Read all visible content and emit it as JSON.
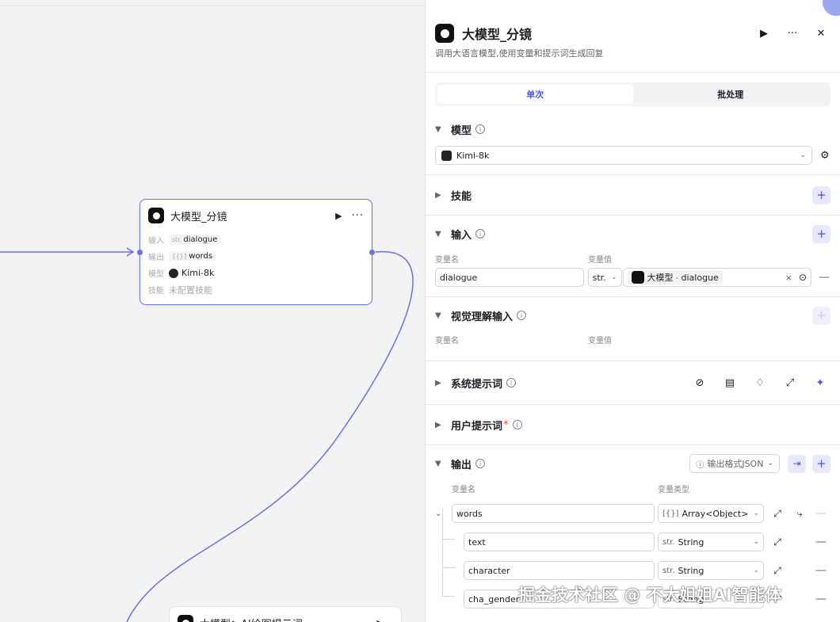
{
  "canvas": {
    "node_main": {
      "title": "大模型_分镜",
      "input_label": "输入",
      "input_type": "str.",
      "input_value": "dialogue",
      "output_label": "输出",
      "output_type": "[{}]",
      "output_value": "words",
      "model_label": "模型",
      "model_value": "Kimi-8k",
      "skill_label": "技能",
      "skill_value": "未配置技能"
    },
    "node_second": {
      "title": "大模型：AI绘图提示词"
    },
    "edge_color": "#6b6fe0"
  },
  "panel": {
    "title": "大模型_分镜",
    "description": "调用大语言模型,使用变量和提示词生成回复",
    "tabs": [
      {
        "label": "单次",
        "active": true
      },
      {
        "label": "批处理",
        "active": false
      }
    ],
    "model_section": {
      "title": "模型",
      "selected": "Kimi-8k"
    },
    "skill_section": {
      "title": "技能"
    },
    "input_section": {
      "title": "输入",
      "col_name": "变量名",
      "col_value": "变量值",
      "row": {
        "name": "dialogue",
        "type": "str.",
        "ref_node": "大模型",
        "ref_sep": "-",
        "ref_var": "dialogue"
      }
    },
    "visual_section": {
      "title": "视觉理解输入",
      "col_name": "变量名",
      "col_value": "变量值"
    },
    "system_prompt_section": {
      "title": "系统提示词"
    },
    "user_prompt_section": {
      "title": "用户提示词",
      "required_mark": "*"
    },
    "output_section": {
      "title": "输出",
      "format_label": "输出格式JSON",
      "col_name": "变量名",
      "col_type": "变量类型",
      "rows": [
        {
          "name": "words",
          "type_prefix": "[{}]",
          "type": "Array<Object>"
        },
        {
          "name": "text",
          "type_prefix": "str.",
          "type": "String"
        },
        {
          "name": "character",
          "type_prefix": "str.",
          "type": "String"
        },
        {
          "name": "cha_gender",
          "type_prefix": "str.",
          "type": "String"
        }
      ]
    }
  },
  "watermark": "掘金技术社区 @ 不大姐姐AI智能体",
  "accent_color": "#4d53e8"
}
